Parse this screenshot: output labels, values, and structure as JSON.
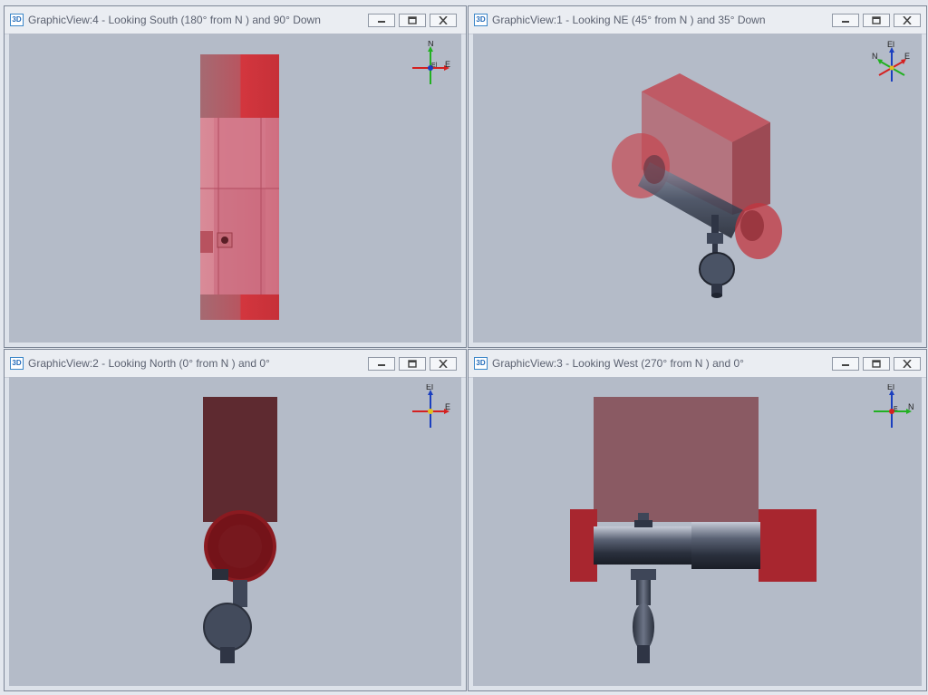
{
  "app_icon_text": "3D",
  "views": [
    {
      "title": "GraphicView:4 - Looking South (180° from N ) and 90° Down",
      "triad": {
        "top": "N",
        "right": "E",
        "center": "El"
      }
    },
    {
      "title": "GraphicView:1 - Looking NE (45° from N ) and 35° Down",
      "triad": {
        "top": "El",
        "left": "N",
        "right": "E"
      }
    },
    {
      "title": "GraphicView:2 - Looking North (0° from N ) and 0°",
      "triad": {
        "top": "El",
        "right": "E"
      }
    },
    {
      "title": "GraphicView:3 - Looking West (270° from N ) and 0°",
      "triad": {
        "top": "El",
        "right": "N",
        "center": "E"
      }
    }
  ],
  "icons": {
    "minimize": "minimize-icon",
    "restore": "restore-icon",
    "close": "close-icon"
  },
  "colors": {
    "red": "#c3323b",
    "steel": "#3e4658",
    "viewport": "#b4bbc8",
    "triad_x": "#d42020",
    "triad_y": "#22b022",
    "triad_z": "#1b3fbf"
  }
}
